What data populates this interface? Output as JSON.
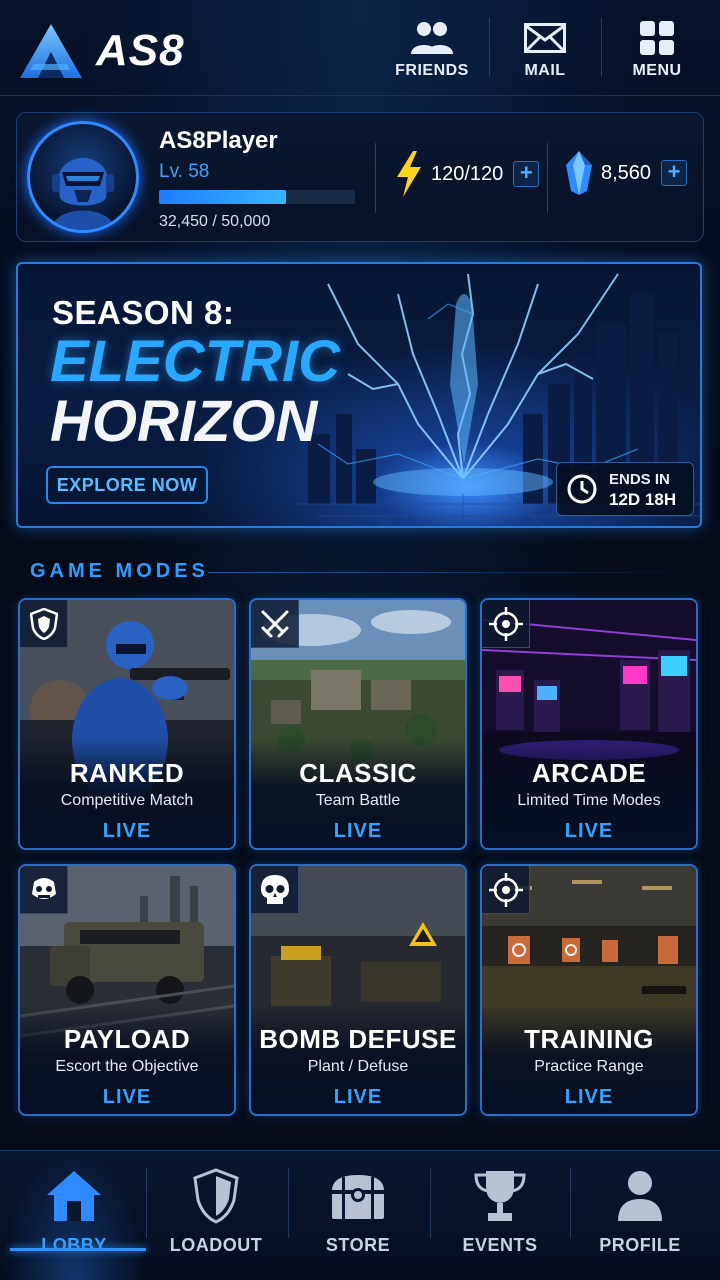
{
  "app": {
    "logo_text": "AS8"
  },
  "header": {
    "buttons": [
      {
        "label": "FRIENDS",
        "icon": "friends-icon"
      },
      {
        "label": "MAIL",
        "icon": "mail-icon"
      },
      {
        "label": "MENU",
        "icon": "menu-grid-icon"
      }
    ]
  },
  "profile": {
    "name": "AS8Player",
    "level": "Lv. 58",
    "xp_text": "32,450 / 50,000",
    "xp_progress": 0.649,
    "energy": "120/120",
    "gems": "8,560",
    "energy_add": "+",
    "gems_add": "+"
  },
  "banner": {
    "season": "SEASON 8:",
    "name_line1": "ELECTRIC",
    "name_line2": "HORIZON",
    "cta": "EXPLORE NOW",
    "ends_label": "ENDS IN",
    "ends_value": "12D 18H"
  },
  "game_modes": {
    "title": "GAME MODES",
    "cards": [
      {
        "title": "RANKED",
        "subtitle": "Competitive Match",
        "status": "LIVE",
        "icon": "shield-icon"
      },
      {
        "title": "CLASSIC",
        "subtitle": "Team Battle",
        "status": "LIVE",
        "icon": "crossed-swords-icon"
      },
      {
        "title": "ARCADE",
        "subtitle": "Limited Time Modes",
        "status": "LIVE",
        "icon": "crosshair-icon"
      },
      {
        "title": "PAYLOAD",
        "subtitle": "Escort the Objective",
        "status": "LIVE",
        "icon": "payload-icon"
      },
      {
        "title": "BOMB DEFUSE",
        "subtitle": "Plant / Defuse",
        "status": "LIVE",
        "icon": "skull-icon"
      },
      {
        "title": "TRAINING",
        "subtitle": "Practice Range",
        "status": "LIVE",
        "icon": "crosshair-icon"
      }
    ]
  },
  "nav": {
    "items": [
      {
        "label": "LOBBY",
        "icon": "home-icon",
        "active": true
      },
      {
        "label": "LOADOUT",
        "icon": "shield-icon",
        "active": false
      },
      {
        "label": "STORE",
        "icon": "chest-icon",
        "active": false
      },
      {
        "label": "EVENTS",
        "icon": "trophy-icon",
        "active": false
      },
      {
        "label": "PROFILE",
        "icon": "user-icon",
        "active": false
      }
    ]
  },
  "colors": {
    "accent": "#2e9cff",
    "energy": "#ffd21f",
    "gem": "#2f8bff",
    "background": "#050b18"
  }
}
